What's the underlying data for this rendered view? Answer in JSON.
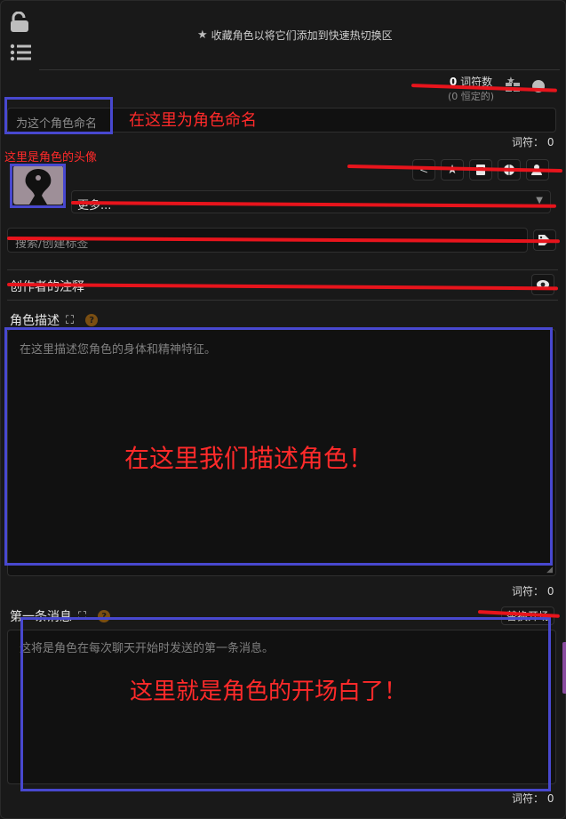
{
  "header": {
    "favorite_hint": "收藏角色以将它们添加到快速热切换区",
    "token_count": "0",
    "token_label": "词符数",
    "token_permanent": "(0 恒定的)"
  },
  "name_field": {
    "placeholder": "为这个角色命名"
  },
  "annotations": {
    "name_note": "在这里为角色命名",
    "avatar_note": "这里是角色的头像",
    "description_note": "在这里我们描述角色！",
    "first_message_note": "这里就是角色的开场白了！"
  },
  "name_token": "词符：  0",
  "more_select": {
    "value": "更多..."
  },
  "tags_field": {
    "placeholder": "搜索/创建标签"
  },
  "creator_notes": {
    "label": "创作者的注释"
  },
  "description": {
    "label": "角色描述",
    "placeholder": "在这里描述您角色的身体和精神特征。",
    "token": "词符：  0"
  },
  "first_message": {
    "label": "第一条消息",
    "alt_button": "替换开场",
    "placeholder": "这将是角色在每次聊天开始时发送的第一条消息。",
    "token": "词符：  0"
  },
  "colors": {
    "accent_red": "#e8141c",
    "annotation_blue": "#4848cf",
    "help_badge": "#7a4e12"
  }
}
